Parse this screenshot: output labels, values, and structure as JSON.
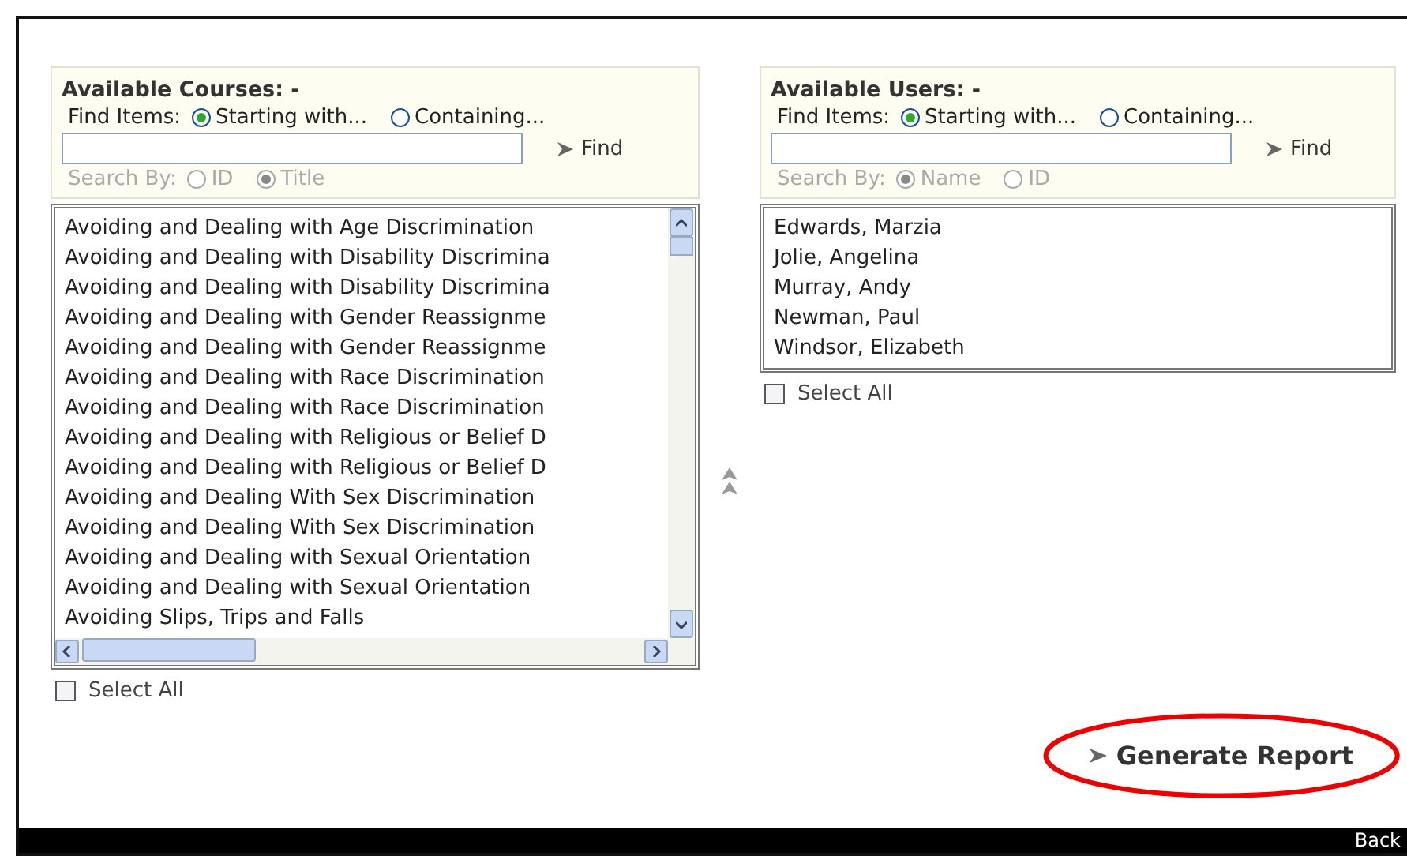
{
  "panels": [
    {
      "title": "Available Courses: -",
      "find_label": "Find Items:",
      "find_options": [
        {
          "label": "Starting with...",
          "selected": true
        },
        {
          "label": "Containing...",
          "selected": false
        }
      ],
      "find_button": "Find",
      "search_by_label": "Search By:",
      "search_by_disabled": true,
      "search_by_options": [
        {
          "label": "ID",
          "selected": false
        },
        {
          "label": "Title",
          "selected": true
        }
      ],
      "scrollbars": true,
      "items": [
        "Avoiding and Dealing with Age Discrimination",
        "Avoiding and Dealing with Disability Discrimina",
        "Avoiding and Dealing with Disability Discrimina",
        "Avoiding and Dealing with Gender Reassignme",
        "Avoiding and Dealing with Gender Reassignme",
        "Avoiding and Dealing with Race Discrimination",
        "Avoiding and Dealing with Race Discrimination",
        "Avoiding and Dealing with Religious or Belief D",
        "Avoiding and Dealing with Religious or Belief D",
        "Avoiding and Dealing With Sex Discrimination",
        "Avoiding and Dealing With Sex Discrimination",
        "Avoiding and Dealing with Sexual Orientation",
        "Avoiding and Dealing with Sexual Orientation",
        "Avoiding Slips, Trips and Falls"
      ],
      "select_all": {
        "label": "Select All",
        "checked": false
      }
    },
    {
      "title": "Available Users: -",
      "find_label": "Find Items:",
      "find_options": [
        {
          "label": "Starting with...",
          "selected": true
        },
        {
          "label": "Containing...",
          "selected": false
        }
      ],
      "find_button": "Find",
      "search_by_label": "Search By:",
      "search_by_disabled": true,
      "search_by_options": [
        {
          "label": "Name",
          "selected": true
        },
        {
          "label": "ID",
          "selected": false
        }
      ],
      "scrollbars": false,
      "items": [
        "Edwards, Marzia",
        "Jolie, Angelina",
        "Murray, Andy",
        "Newman, Paul",
        "Windsor, Elizabeth"
      ],
      "select_all": {
        "label": "Select All",
        "checked": false
      }
    }
  ],
  "generate_button": {
    "label": "Generate Report",
    "highlighted": true
  },
  "footer": {
    "link": "Back"
  }
}
